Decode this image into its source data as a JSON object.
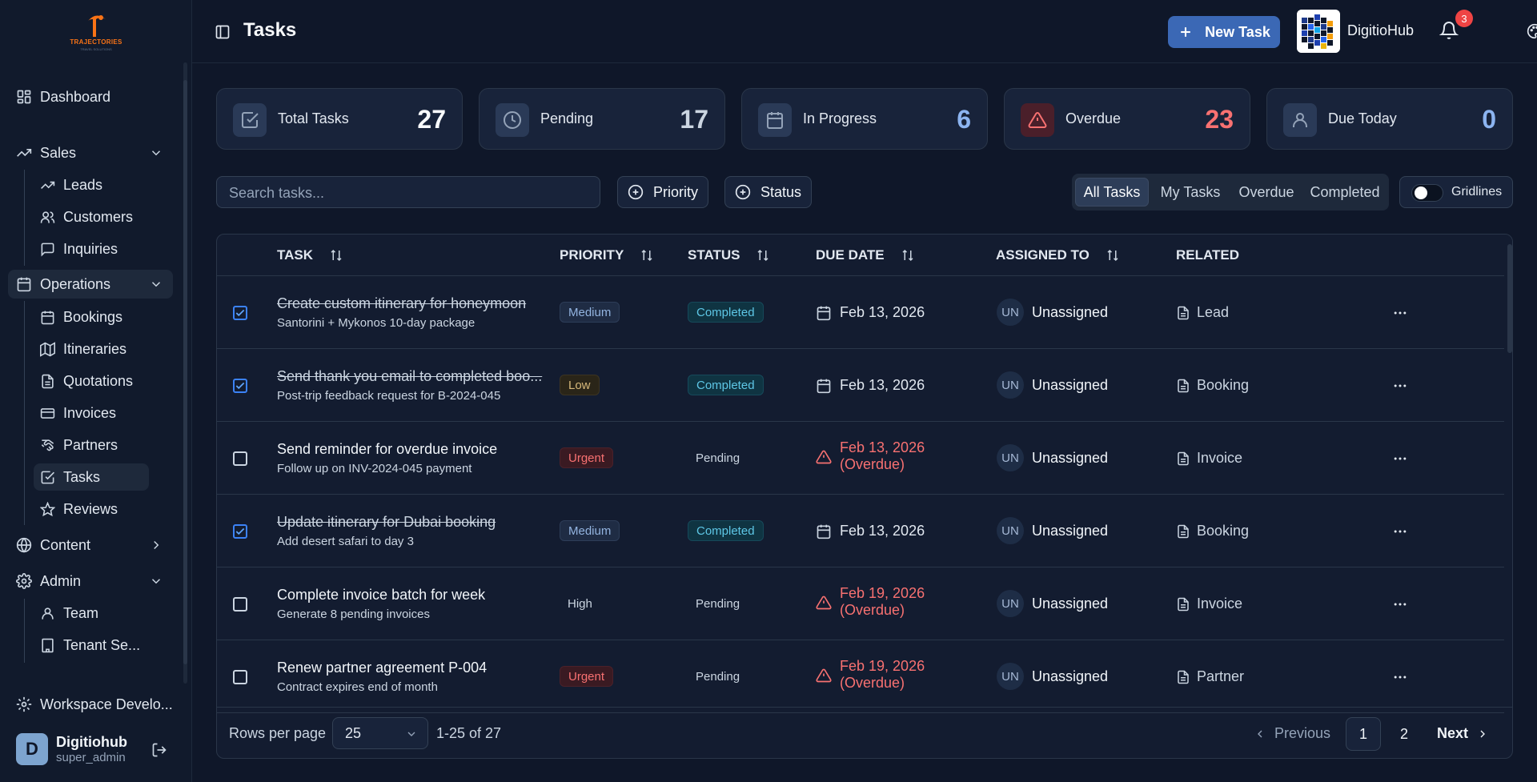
{
  "brand": {
    "logo_text": "TRAJECTORIES",
    "logo_sub": "TRAVEL SOLUTIONS",
    "name": "DigitioHub"
  },
  "sidebar": {
    "dashboard": "Dashboard",
    "sales": {
      "label": "Sales",
      "items": [
        "Leads",
        "Customers",
        "Inquiries"
      ]
    },
    "operations": {
      "label": "Operations",
      "items": [
        "Bookings",
        "Itineraries",
        "Quotations",
        "Invoices",
        "Partners",
        "Tasks",
        "Reviews"
      ]
    },
    "content": "Content",
    "admin": {
      "label": "Admin",
      "items": [
        "Team",
        "Tenant Se..."
      ]
    },
    "workspace": "Workspace Develo...",
    "user": {
      "initial": "D",
      "name": "Digitiohub",
      "role": "super_admin"
    }
  },
  "header": {
    "title": "Tasks",
    "new_task": "New Task",
    "notifications": "3"
  },
  "stats": [
    {
      "label": "Total Tasks",
      "value": "27",
      "color": "#f8fafc",
      "icon": "check-square-icon"
    },
    {
      "label": "Pending",
      "value": "17",
      "color": "#cbd5e1",
      "icon": "clock-icon"
    },
    {
      "label": "In Progress",
      "value": "6",
      "color": "#8cb4f0",
      "icon": "calendar-icon"
    },
    {
      "label": "Overdue",
      "value": "23",
      "color": "#f87171",
      "icon": "alert-triangle-icon"
    },
    {
      "label": "Due Today",
      "value": "0",
      "color": "#8cb4f0",
      "icon": "user-icon"
    }
  ],
  "toolbar": {
    "search_placeholder": "Search tasks...",
    "priority": "Priority",
    "status": "Status",
    "views": [
      "All Tasks",
      "My Tasks",
      "Overdue",
      "Completed"
    ],
    "active_view": "All Tasks",
    "gridlines": "Gridlines",
    "gridlines_on": false
  },
  "table": {
    "columns": [
      "TASK",
      "PRIORITY",
      "STATUS",
      "DUE DATE",
      "ASSIGNED TO",
      "RELATED"
    ],
    "rows": [
      {
        "checked": true,
        "title": "Create custom itinerary for honeymoon",
        "desc": "Santorini + Mykonos 10-day package",
        "priority": "Medium",
        "status": "Completed",
        "due": "Feb 13, 2026",
        "overdue": "",
        "assignee_initials": "UN",
        "assignee": "Unassigned",
        "related": "Lead"
      },
      {
        "checked": true,
        "title": "Send thank you email to completed boo...",
        "desc": "Post-trip feedback request for B-2024-045",
        "priority": "Low",
        "status": "Completed",
        "due": "Feb 13, 2026",
        "overdue": "",
        "assignee_initials": "UN",
        "assignee": "Unassigned",
        "related": "Booking"
      },
      {
        "checked": false,
        "title": "Send reminder for overdue invoice",
        "desc": "Follow up on INV-2024-045 payment",
        "priority": "Urgent",
        "status": "Pending",
        "due": "Feb 13, 2026",
        "overdue": "(Overdue)",
        "assignee_initials": "UN",
        "assignee": "Unassigned",
        "related": "Invoice"
      },
      {
        "checked": true,
        "title": "Update itinerary for Dubai booking",
        "desc": "Add desert safari to day 3",
        "priority": "Medium",
        "status": "Completed",
        "due": "Feb 13, 2026",
        "overdue": "",
        "assignee_initials": "UN",
        "assignee": "Unassigned",
        "related": "Booking"
      },
      {
        "checked": false,
        "title": "Complete invoice batch for week",
        "desc": "Generate 8 pending invoices",
        "priority": "High",
        "status": "Pending",
        "due": "Feb 19, 2026",
        "overdue": "(Overdue)",
        "assignee_initials": "UN",
        "assignee": "Unassigned",
        "related": "Invoice"
      },
      {
        "checked": false,
        "title": "Renew partner agreement P-004",
        "desc": "Contract expires end of month",
        "priority": "Urgent",
        "status": "Pending",
        "due": "Feb 19, 2026",
        "overdue": "(Overdue)",
        "assignee_initials": "UN",
        "assignee": "Unassigned",
        "related": "Partner"
      }
    ]
  },
  "footer": {
    "rows_label": "Rows per page",
    "rows_value": "25",
    "range": "1-25 of 27",
    "previous": "Previous",
    "pages": [
      "1",
      "2"
    ],
    "current_page": "1",
    "next": "Next"
  }
}
